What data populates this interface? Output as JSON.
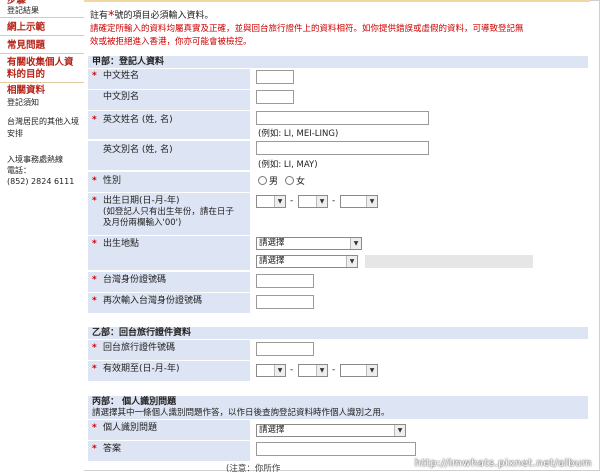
{
  "sidebar": {
    "top_cut": "步驟",
    "items": [
      {
        "label": "登記結果",
        "style": "dark"
      },
      {
        "label": "網上示範",
        "style": "red"
      },
      {
        "label": "常見問題",
        "style": "red"
      },
      {
        "label": "有關收集個人資",
        "style": "red"
      },
      {
        "label": "料的目的",
        "style": "red"
      },
      {
        "label": "相關資料",
        "style": "red"
      },
      {
        "label": "登記須知",
        "style": "dark"
      },
      {
        "label": "台灣居民的其他入境",
        "style": "dark"
      },
      {
        "label": "安排",
        "style": "dark"
      }
    ],
    "hotline_title": "入境事務處熱線",
    "hotline_label": "電話：",
    "hotline_number": "(852) 2824 6111"
  },
  "intro": {
    "line1_prefix": "註有",
    "star": "*",
    "line1_suffix": "號的項目必須輸入資料。",
    "line2": "請確定所輸入的資料均屬真實及正確，並與回台旅行證件上的資料相符。如你提供錯誤或虛假的資料，可導致登記無",
    "line3": "效或被拒絕進入香港，你亦可能會被檢控。"
  },
  "section_a": {
    "title": "甲部：登記人資料",
    "chinese_name": {
      "label": "中文姓名",
      "required": true
    },
    "chinese_alias": {
      "label": "中文別名",
      "required": false
    },
    "english_name": {
      "label": "英文姓名 (姓, 名)",
      "required": true,
      "example": "(例如: LI, MEI-LING)"
    },
    "english_alias": {
      "label": "英文別名 (姓, 名)",
      "required": false,
      "example": "(例如: LI, MAY)"
    },
    "sex": {
      "label": "性別",
      "required": true,
      "options": [
        "男",
        "女"
      ]
    },
    "dob": {
      "label": "出生日期(日-月-年)",
      "required": true,
      "note1": "(如登記人只有出生年份，請在日子",
      "note2": "及月份兩欄輸入'00')",
      "sep": "-"
    },
    "birthplace": {
      "label": "出生地點",
      "required": true,
      "select1": "請選擇",
      "select2": "請選擇"
    },
    "taiwan_id": {
      "label": "台灣身份證號碼",
      "required": true
    },
    "taiwan_id_confirm": {
      "label": "再次輸入台灣身份證號碼",
      "required": true
    }
  },
  "section_b": {
    "title": "乙部：回台旅行證件資料",
    "doc_number": {
      "label": "回台旅行證件號碼",
      "required": true
    },
    "expiry": {
      "label": "有效期至(日-月-年)",
      "required": true,
      "sep": "-"
    }
  },
  "section_c": {
    "title": "丙部： 個人識別問題",
    "subtitle": "請選擇其中一條個人識別問題作答，以作日後查詢登記資料時作個人識別之用。",
    "question": {
      "label": "個人識別問題",
      "required": true,
      "select": "請選擇"
    },
    "answer": {
      "label": "答案",
      "required": true
    }
  },
  "bottom_note": "(注意：你所作",
  "watermark": "http://imwhats.pixnet.net/album"
}
